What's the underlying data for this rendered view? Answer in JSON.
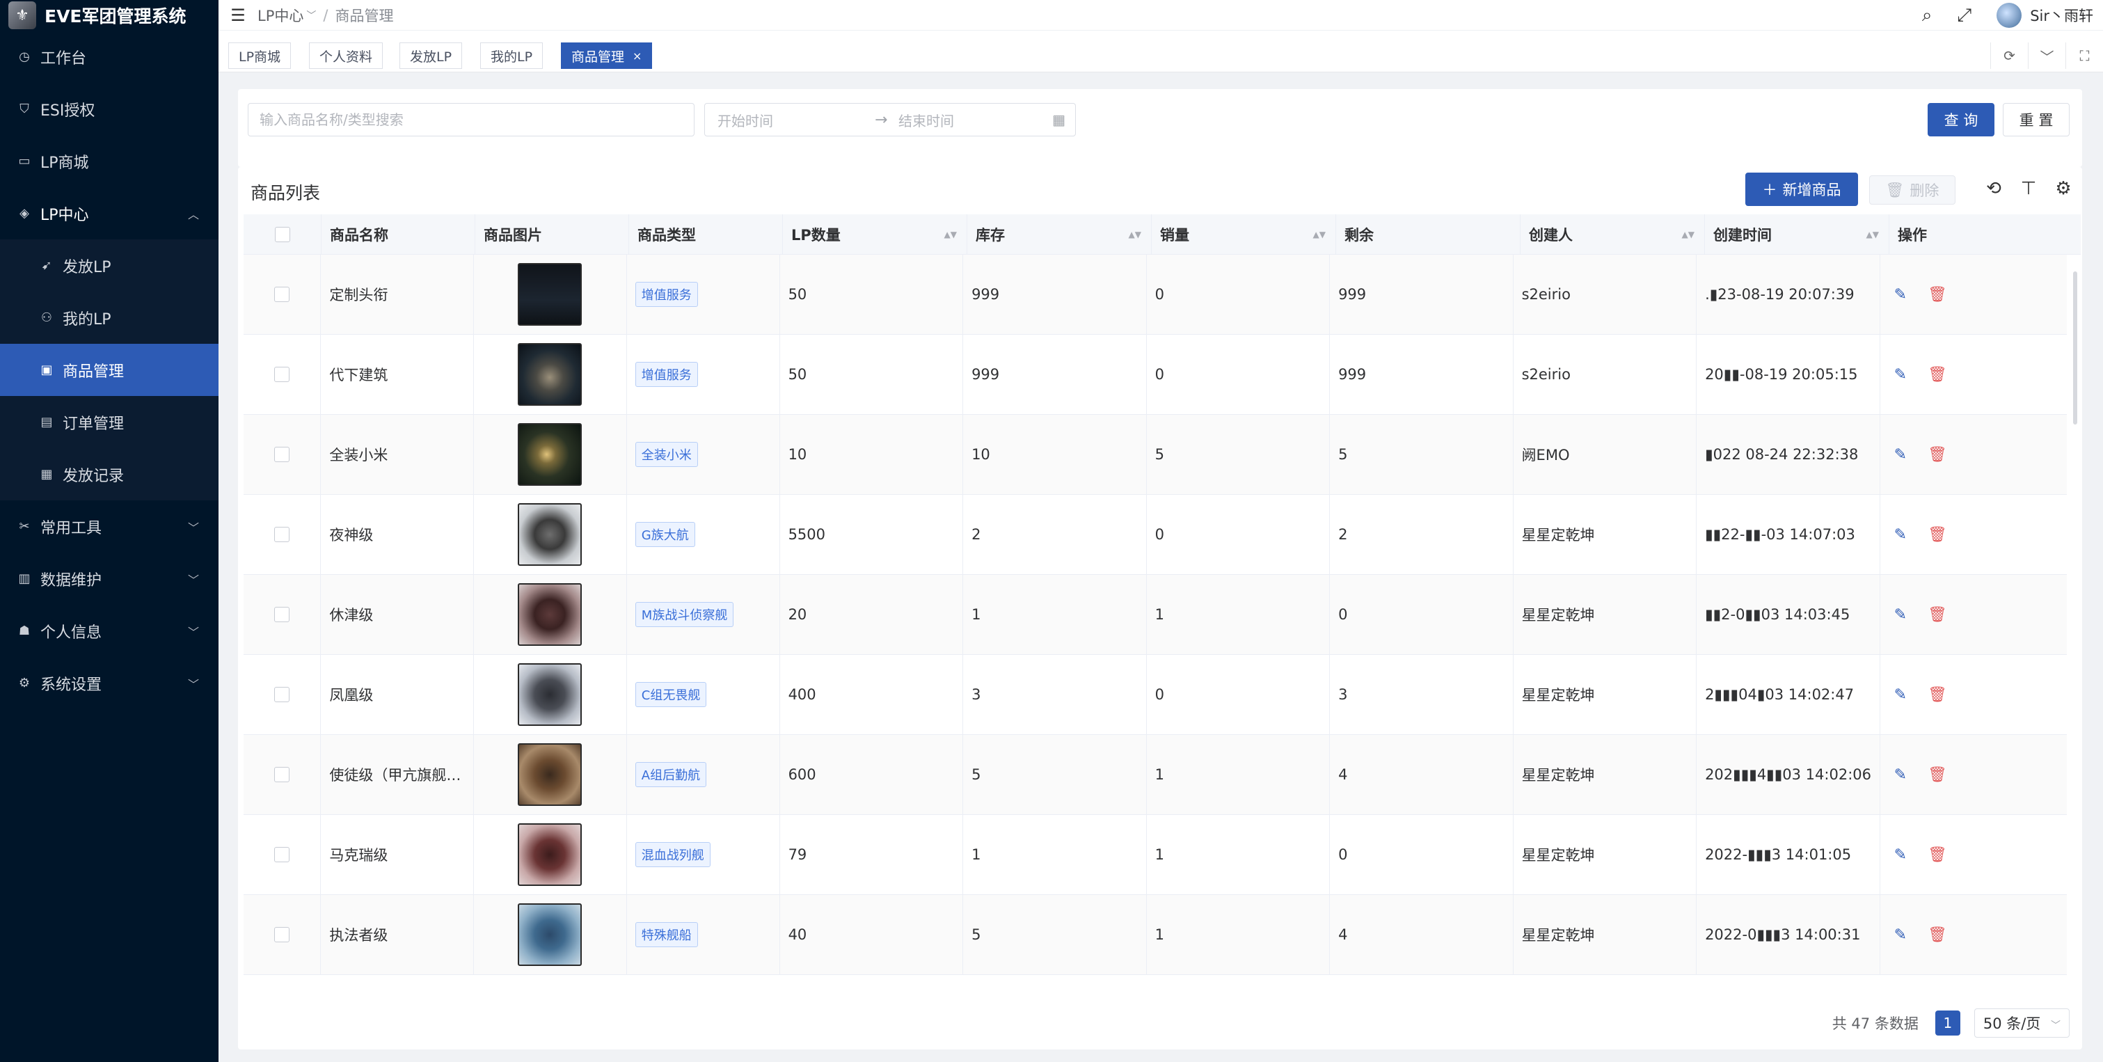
{
  "app": {
    "title": "EVE军团管理系统"
  },
  "sidebar": {
    "items": [
      {
        "label": "工作台",
        "icon": "dashboard-icon"
      },
      {
        "label": "ESI授权",
        "icon": "shield-icon"
      },
      {
        "label": "LP商城",
        "icon": "store-icon"
      },
      {
        "label": "LP中心",
        "icon": "tag-icon",
        "expanded": true
      }
    ],
    "submenu": [
      {
        "label": "发放LP",
        "icon": "send-icon"
      },
      {
        "label": "我的LP",
        "icon": "user-lp-icon"
      },
      {
        "label": "商品管理",
        "icon": "goods-icon",
        "active": true
      },
      {
        "label": "订单管理",
        "icon": "order-icon"
      },
      {
        "label": "发放记录",
        "icon": "record-icon"
      }
    ],
    "groups": [
      {
        "label": "常用工具",
        "icon": "tools-icon"
      },
      {
        "label": "数据维护",
        "icon": "database-icon"
      },
      {
        "label": "个人信息",
        "icon": "person-icon"
      },
      {
        "label": "系统设置",
        "icon": "settings-icon"
      }
    ]
  },
  "header": {
    "breadcrumb": [
      "LP中心",
      "商品管理"
    ],
    "username": "Sir丶雨轩"
  },
  "tabs": [
    {
      "label": "LP商城"
    },
    {
      "label": "个人资料"
    },
    {
      "label": "发放LP"
    },
    {
      "label": "我的LP"
    },
    {
      "label": "商品管理",
      "active": true
    }
  ],
  "search": {
    "keyword_placeholder": "输入商品名称/类型搜索",
    "start_placeholder": "开始时间",
    "end_placeholder": "结束时间",
    "query_label": "查 询",
    "reset_label": "重 置"
  },
  "table": {
    "title": "商品列表",
    "add_label": "新增商品",
    "delete_label": "删除",
    "columns": [
      "商品名称",
      "商品图片",
      "商品类型",
      "LP数量",
      "库存",
      "销量",
      "剩余",
      "创建人",
      "创建时间",
      "操作"
    ],
    "rows": [
      {
        "name": "定制头衔",
        "type": "增值服务",
        "lp": "50",
        "stock": "999",
        "sold": "0",
        "left": "999",
        "creator": "s2eirio",
        "time": ".▮23-08-19 20:07:39",
        "thumb": "dark-text"
      },
      {
        "name": "代下建筑",
        "type": "增值服务",
        "lp": "50",
        "stock": "999",
        "sold": "0",
        "left": "999",
        "creator": "s2eirio",
        "time": "20▮▮-08-19 20:05:15",
        "thumb": "structure"
      },
      {
        "name": "全装小米",
        "type": "全装小米",
        "lp": "10",
        "stock": "10",
        "sold": "5",
        "left": "5",
        "creator": "阙EMO",
        "time": "▮022 08-24 22:32:38",
        "thumb": "space-battle"
      },
      {
        "name": "夜神级",
        "type": "G族大航",
        "lp": "5500",
        "stock": "2",
        "sold": "0",
        "left": "2",
        "creator": "星星定乾坤",
        "time": "▮▮22-▮▮-03 14:07:03",
        "thumb": "grey-ship"
      },
      {
        "name": "休津级",
        "type": "M族战斗侦察舰",
        "lp": "20",
        "stock": "1",
        "sold": "1",
        "left": "0",
        "creator": "星星定乾坤",
        "time": "▮▮2-0▮▮03 14:03:45",
        "thumb": "red-ship"
      },
      {
        "name": "凤凰级",
        "type": "C组无畏舰",
        "lp": "400",
        "stock": "3",
        "sold": "0",
        "left": "3",
        "creator": "星星定乾坤",
        "time": "2▮▮▮04▮03 14:02:47",
        "thumb": "dark-ship"
      },
      {
        "name": "使徒级（甲亢旗舰…",
        "type": "A组后勤航",
        "lp": "600",
        "stock": "5",
        "sold": "1",
        "left": "4",
        "creator": "星星定乾坤",
        "time": "202▮▮▮4▮▮03 14:02:06",
        "thumb": "gold-ship"
      },
      {
        "name": "马克瑞级",
        "type": "混血战列舰",
        "lp": "79",
        "stock": "1",
        "sold": "1",
        "left": "0",
        "creator": "星星定乾坤",
        "time": "2022-▮▮▮3 14:01:05",
        "thumb": "rust-ship"
      },
      {
        "name": "执法者级",
        "type": "特殊舰船",
        "lp": "40",
        "stock": "5",
        "sold": "1",
        "left": "4",
        "creator": "星星定乾坤",
        "time": "2022-0▮▮▮3 14:00:31",
        "thumb": "blue-ship"
      }
    ]
  },
  "pagination": {
    "total_text": "共 47 条数据",
    "current_page": "1",
    "page_size": "50 条/页"
  },
  "colors": {
    "sidebar_bg": "#001529",
    "primary": "#2d5bb5",
    "danger": "#e25a5a"
  }
}
